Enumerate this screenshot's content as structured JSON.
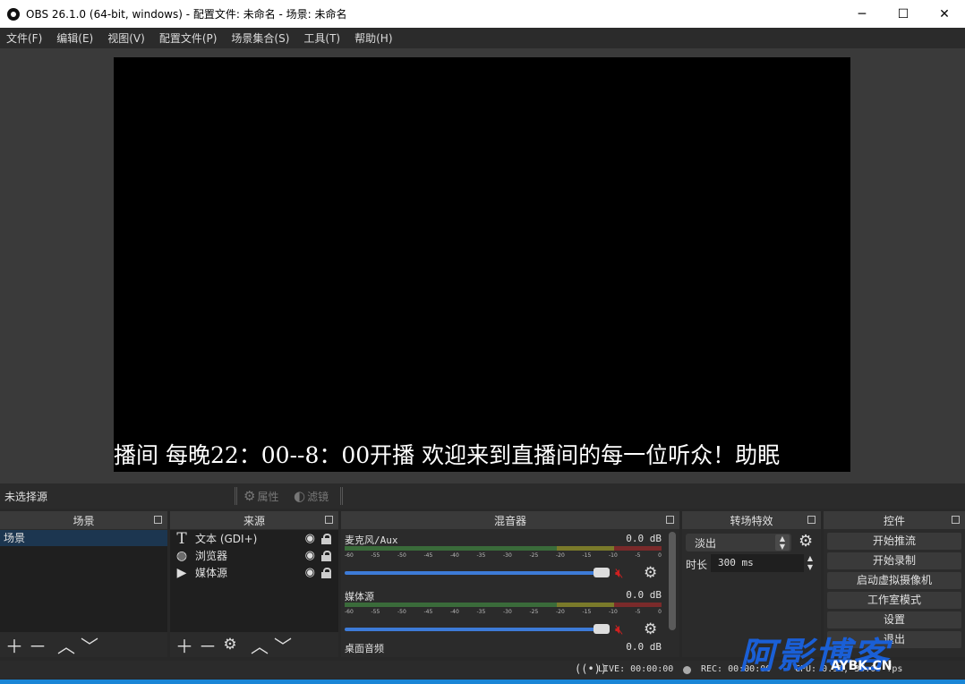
{
  "window": {
    "title": "OBS 26.1.0 (64-bit, windows) - 配置文件: 未命名 - 场景: 未命名",
    "minimize": "─",
    "maximize": "☐",
    "close": "✕"
  },
  "menu": [
    "文件(F)",
    "编辑(E)",
    "视图(V)",
    "配置文件(P)",
    "场景集合(S)",
    "工具(T)",
    "帮助(H)"
  ],
  "preview": {
    "overlay_text": "播间 每晚22：00--8：00开播 欢迎来到直播间的每一位听众！助眠"
  },
  "source_bar": {
    "no_source": "未选择源",
    "properties": "属性",
    "filters": "滤镜"
  },
  "docks": {
    "scenes": {
      "title": "场景",
      "items": [
        "场景"
      ]
    },
    "sources": {
      "title": "来源",
      "items": [
        {
          "icon": "text-icon",
          "glyph": "T",
          "label": "文本 (GDI+)"
        },
        {
          "icon": "globe-icon",
          "glyph": "◍",
          "label": "浏览器"
        },
        {
          "icon": "play-icon",
          "glyph": "▶",
          "label": "媒体源"
        }
      ]
    },
    "mixer": {
      "title": "混音器",
      "tracks": [
        {
          "name": "麦克风/Aux",
          "db": "0.0 dB"
        },
        {
          "name": "媒体源",
          "db": "0.0 dB"
        },
        {
          "name": "桌面音频",
          "db": "0.0 dB"
        }
      ],
      "scale": [
        "-60",
        "-55",
        "-50",
        "-45",
        "-40",
        "-35",
        "-30",
        "-25",
        "-20",
        "-15",
        "-10",
        "-5",
        "0"
      ]
    },
    "transitions": {
      "title": "转场特效",
      "selected": "淡出",
      "duration_label": "时长",
      "duration_value": "300 ms"
    },
    "controls": {
      "title": "控件",
      "buttons": [
        "开始推流",
        "开始录制",
        "启动虚拟摄像机",
        "工作室模式",
        "设置",
        "退出"
      ]
    }
  },
  "status": {
    "live": "LIVE: 00:00:00",
    "rec": "REC: 00:00:00",
    "cpu": "CPU: 0.9%, 30.00 fps"
  },
  "watermark": {
    "text": "阿影博客",
    "domain": "AYBK.CN"
  },
  "colors": {
    "accent": "#1a86d6",
    "fader": "#3d7bd8",
    "mute": "#d02020",
    "watermark": "#1a5fd6"
  }
}
